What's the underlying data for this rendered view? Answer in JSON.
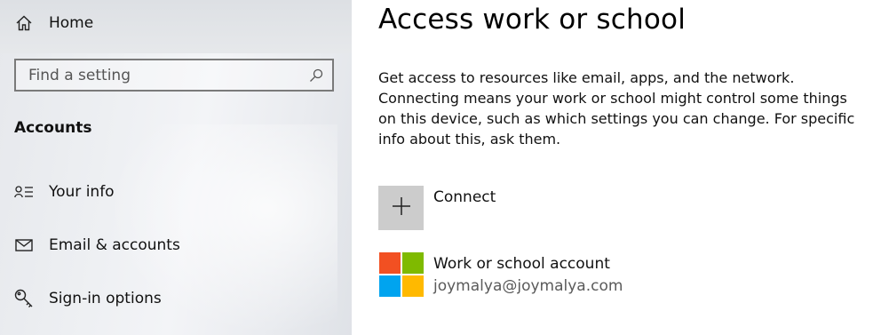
{
  "sidebar": {
    "home_label": "Home",
    "search": {
      "placeholder": "Find a setting"
    },
    "section_title": "Accounts",
    "items": [
      {
        "label": "Your info",
        "icon": "person-list-icon"
      },
      {
        "label": "Email & accounts",
        "icon": "mail-icon"
      },
      {
        "label": "Sign-in options",
        "icon": "key-icon"
      }
    ]
  },
  "main": {
    "title": "Access work or school",
    "description": "Get access to resources like email, apps, and the network. Connecting means your work or school might control some things on this device, such as which settings you can change. For specific info about this, ask them.",
    "connect_label": "Connect",
    "account": {
      "name": "Work or school account",
      "email": "joymalya@joymalya.com"
    }
  },
  "colors": {
    "connect_tile": "#cccccc",
    "ms_red": "#f25022",
    "ms_green": "#7fba00",
    "ms_blue": "#00a4ef",
    "ms_yellow": "#ffb900"
  }
}
